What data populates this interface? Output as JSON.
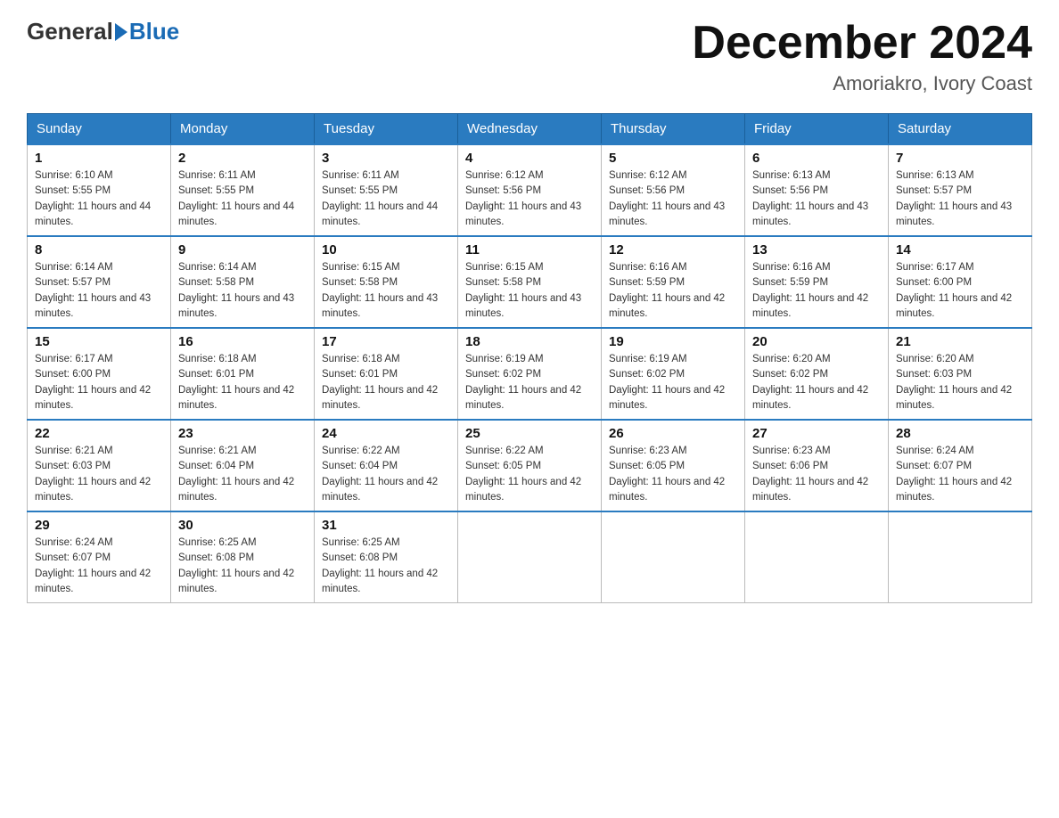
{
  "header": {
    "logo_general": "General",
    "logo_blue": "Blue",
    "month_title": "December 2024",
    "location": "Amoriakro, Ivory Coast"
  },
  "weekdays": [
    "Sunday",
    "Monday",
    "Tuesday",
    "Wednesday",
    "Thursday",
    "Friday",
    "Saturday"
  ],
  "weeks": [
    [
      {
        "day": "1",
        "sunrise": "6:10 AM",
        "sunset": "5:55 PM",
        "daylight": "11 hours and 44 minutes."
      },
      {
        "day": "2",
        "sunrise": "6:11 AM",
        "sunset": "5:55 PM",
        "daylight": "11 hours and 44 minutes."
      },
      {
        "day": "3",
        "sunrise": "6:11 AM",
        "sunset": "5:55 PM",
        "daylight": "11 hours and 44 minutes."
      },
      {
        "day": "4",
        "sunrise": "6:12 AM",
        "sunset": "5:56 PM",
        "daylight": "11 hours and 43 minutes."
      },
      {
        "day": "5",
        "sunrise": "6:12 AM",
        "sunset": "5:56 PM",
        "daylight": "11 hours and 43 minutes."
      },
      {
        "day": "6",
        "sunrise": "6:13 AM",
        "sunset": "5:56 PM",
        "daylight": "11 hours and 43 minutes."
      },
      {
        "day": "7",
        "sunrise": "6:13 AM",
        "sunset": "5:57 PM",
        "daylight": "11 hours and 43 minutes."
      }
    ],
    [
      {
        "day": "8",
        "sunrise": "6:14 AM",
        "sunset": "5:57 PM",
        "daylight": "11 hours and 43 minutes."
      },
      {
        "day": "9",
        "sunrise": "6:14 AM",
        "sunset": "5:58 PM",
        "daylight": "11 hours and 43 minutes."
      },
      {
        "day": "10",
        "sunrise": "6:15 AM",
        "sunset": "5:58 PM",
        "daylight": "11 hours and 43 minutes."
      },
      {
        "day": "11",
        "sunrise": "6:15 AM",
        "sunset": "5:58 PM",
        "daylight": "11 hours and 43 minutes."
      },
      {
        "day": "12",
        "sunrise": "6:16 AM",
        "sunset": "5:59 PM",
        "daylight": "11 hours and 42 minutes."
      },
      {
        "day": "13",
        "sunrise": "6:16 AM",
        "sunset": "5:59 PM",
        "daylight": "11 hours and 42 minutes."
      },
      {
        "day": "14",
        "sunrise": "6:17 AM",
        "sunset": "6:00 PM",
        "daylight": "11 hours and 42 minutes."
      }
    ],
    [
      {
        "day": "15",
        "sunrise": "6:17 AM",
        "sunset": "6:00 PM",
        "daylight": "11 hours and 42 minutes."
      },
      {
        "day": "16",
        "sunrise": "6:18 AM",
        "sunset": "6:01 PM",
        "daylight": "11 hours and 42 minutes."
      },
      {
        "day": "17",
        "sunrise": "6:18 AM",
        "sunset": "6:01 PM",
        "daylight": "11 hours and 42 minutes."
      },
      {
        "day": "18",
        "sunrise": "6:19 AM",
        "sunset": "6:02 PM",
        "daylight": "11 hours and 42 minutes."
      },
      {
        "day": "19",
        "sunrise": "6:19 AM",
        "sunset": "6:02 PM",
        "daylight": "11 hours and 42 minutes."
      },
      {
        "day": "20",
        "sunrise": "6:20 AM",
        "sunset": "6:02 PM",
        "daylight": "11 hours and 42 minutes."
      },
      {
        "day": "21",
        "sunrise": "6:20 AM",
        "sunset": "6:03 PM",
        "daylight": "11 hours and 42 minutes."
      }
    ],
    [
      {
        "day": "22",
        "sunrise": "6:21 AM",
        "sunset": "6:03 PM",
        "daylight": "11 hours and 42 minutes."
      },
      {
        "day": "23",
        "sunrise": "6:21 AM",
        "sunset": "6:04 PM",
        "daylight": "11 hours and 42 minutes."
      },
      {
        "day": "24",
        "sunrise": "6:22 AM",
        "sunset": "6:04 PM",
        "daylight": "11 hours and 42 minutes."
      },
      {
        "day": "25",
        "sunrise": "6:22 AM",
        "sunset": "6:05 PM",
        "daylight": "11 hours and 42 minutes."
      },
      {
        "day": "26",
        "sunrise": "6:23 AM",
        "sunset": "6:05 PM",
        "daylight": "11 hours and 42 minutes."
      },
      {
        "day": "27",
        "sunrise": "6:23 AM",
        "sunset": "6:06 PM",
        "daylight": "11 hours and 42 minutes."
      },
      {
        "day": "28",
        "sunrise": "6:24 AM",
        "sunset": "6:07 PM",
        "daylight": "11 hours and 42 minutes."
      }
    ],
    [
      {
        "day": "29",
        "sunrise": "6:24 AM",
        "sunset": "6:07 PM",
        "daylight": "11 hours and 42 minutes."
      },
      {
        "day": "30",
        "sunrise": "6:25 AM",
        "sunset": "6:08 PM",
        "daylight": "11 hours and 42 minutes."
      },
      {
        "day": "31",
        "sunrise": "6:25 AM",
        "sunset": "6:08 PM",
        "daylight": "11 hours and 42 minutes."
      },
      null,
      null,
      null,
      null
    ]
  ]
}
